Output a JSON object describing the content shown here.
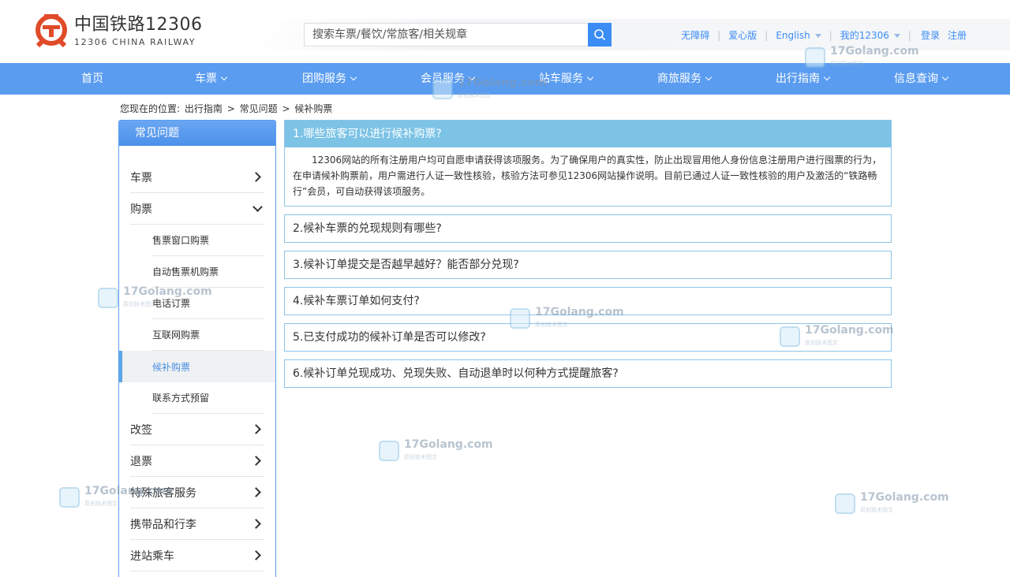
{
  "header": {
    "logo_cn": "中国铁路12306",
    "logo_en": "12306 CHINA RAILWAY",
    "search_placeholder": "搜索车票/餐饮/常旅客/相关规章",
    "links": {
      "accessible": "无障碍",
      "care": "爱心版",
      "lang": "English",
      "my": "我的12306",
      "login": "登录",
      "register": "注册"
    }
  },
  "nav": {
    "items": [
      {
        "label": "首页",
        "has_menu": false
      },
      {
        "label": "车票",
        "has_menu": true
      },
      {
        "label": "团购服务",
        "has_menu": true
      },
      {
        "label": "会员服务",
        "has_menu": true
      },
      {
        "label": "站车服务",
        "has_menu": true
      },
      {
        "label": "商旅服务",
        "has_menu": true
      },
      {
        "label": "出行指南",
        "has_menu": true
      },
      {
        "label": "信息查询",
        "has_menu": true
      }
    ]
  },
  "breadcrumb": {
    "prefix": "您现在的位置:",
    "items": [
      "出行指南",
      "常见问题",
      "候补购票"
    ],
    "sep": ">"
  },
  "sidebar": {
    "title": "常见问题",
    "items": [
      {
        "label": "车票"
      },
      {
        "label": "购票"
      },
      {
        "label": "改签"
      },
      {
        "label": "退票"
      },
      {
        "label": "特殊旅客服务"
      },
      {
        "label": "携带品和行李"
      },
      {
        "label": "进站乘车"
      }
    ],
    "sub_items": [
      {
        "label": "售票窗口购票"
      },
      {
        "label": "自动售票机购票"
      },
      {
        "label": "电话订票"
      },
      {
        "label": "互联网购票"
      },
      {
        "label": "候补购票"
      },
      {
        "label": "联系方式预留"
      }
    ]
  },
  "faq": [
    {
      "q": "1.哪些旅客可以进行候补购票?",
      "a": "12306网站的所有注册用户均可自愿申请获得该项服务。为了确保用户的真实性，防止出现冒用他人身份信息注册用户进行囤票的行为，在申请候补购票前，用户需进行人证一致性核验，核验方法可参见12306网站操作说明。目前已通过人证一致性核验的用户及激活的“铁路畅行”会员，可自动获得该项服务。"
    },
    {
      "q": "2.候补车票的兑现规则有哪些?"
    },
    {
      "q": "3.候补订单提交是否越早越好？能否部分兑现?"
    },
    {
      "q": "4.候补车票订单如何支付?"
    },
    {
      "q": "5.已支付成功的候补订单是否可以修改?"
    },
    {
      "q": "6.候补订单兑现成功、兑现失败、自动退单时以何种方式提醒旅客?"
    }
  ],
  "watermark": {
    "text": "17Golang.com",
    "sub": "原创技术图文"
  },
  "colors": {
    "nav": "#5a9cf0",
    "accent": "#3b8cf5",
    "faq_open": "#7cc3e6",
    "logo": "#e04b2a"
  }
}
